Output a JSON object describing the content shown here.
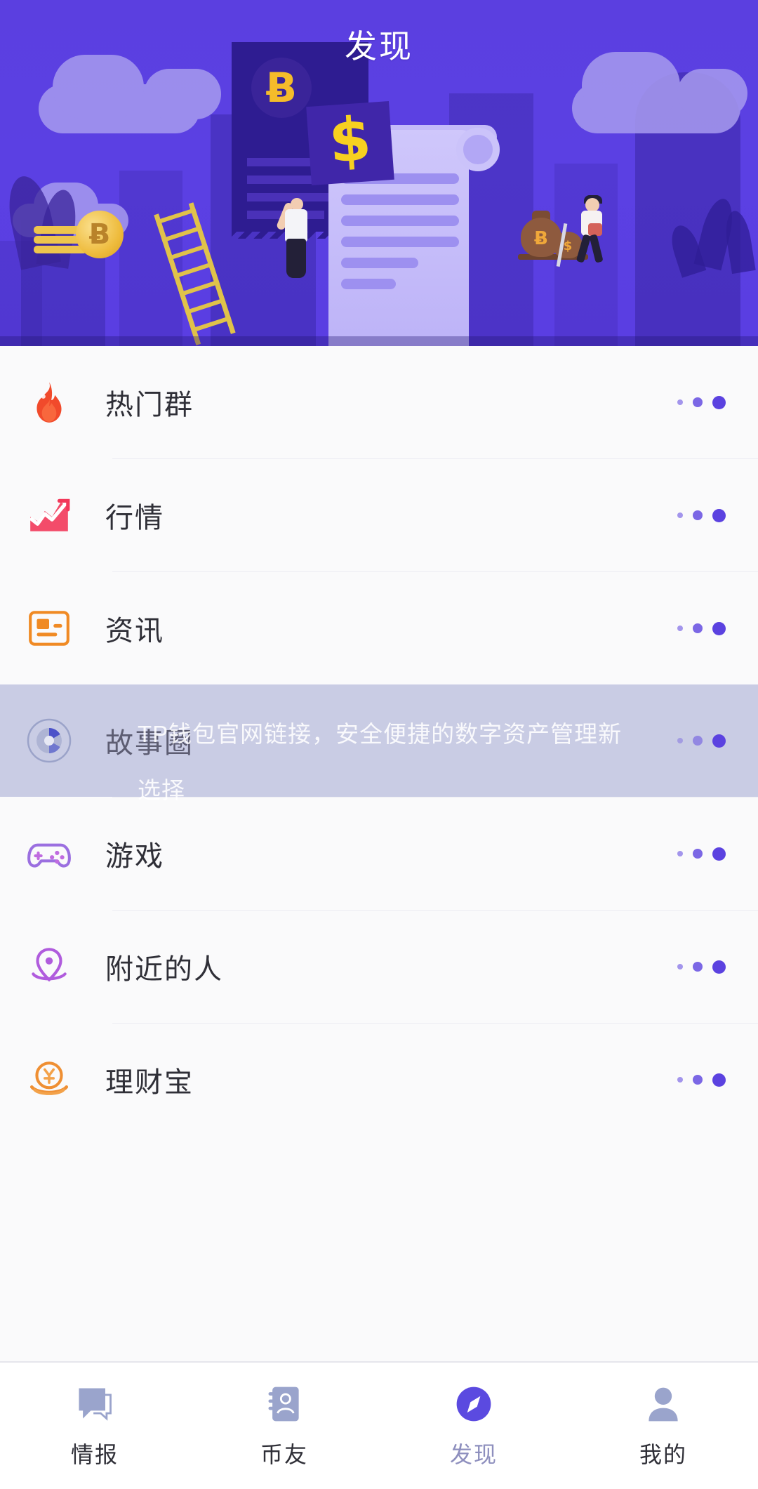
{
  "header": {
    "title": "发现"
  },
  "banner": {
    "alt": "crypto-finance-illustration",
    "btc_symbol": "Ƀ",
    "dollar_symbol": "$",
    "bag_symbol_1": "Ƀ",
    "bag_symbol_2": "$",
    "coin_symbol": "Ƀ"
  },
  "overlay": {
    "watermark": "TP钱包官网链接，安全便捷的数字资产管理新选择"
  },
  "menu": {
    "items": [
      {
        "label": "热门群",
        "icon": "fire-icon",
        "color": "#f14a2b",
        "highlight": false
      },
      {
        "label": "行情",
        "icon": "trend-chart-icon",
        "color": "#f2385a",
        "highlight": false
      },
      {
        "label": "资讯",
        "icon": "news-card-icon",
        "color": "#f08a24",
        "highlight": false
      },
      {
        "label": "故事圈",
        "icon": "aperture-icon",
        "color": "#7b87c4",
        "highlight": true
      },
      {
        "label": "游戏",
        "icon": "gamepad-icon",
        "color": "#9b6fe0",
        "highlight": false
      },
      {
        "label": "附近的人",
        "icon": "location-pin-icon",
        "color": "#b05cdd",
        "highlight": false
      },
      {
        "label": "理财宝",
        "icon": "coin-hand-icon",
        "color": "#ef8f33",
        "highlight": false
      }
    ]
  },
  "tabbar": {
    "items": [
      {
        "label": "情报",
        "icon": "chat-bubble-icon",
        "active": false
      },
      {
        "label": "币友",
        "icon": "contact-book-icon",
        "active": false
      },
      {
        "label": "发现",
        "icon": "compass-icon",
        "active": true
      },
      {
        "label": "我的",
        "icon": "person-icon",
        "active": false
      }
    ]
  },
  "colors": {
    "brand_purple": "#5b40e3",
    "accent_dot": "#5b42e0",
    "highlight_row": "#c9cce4",
    "page_bg": "#fafafb",
    "tab_active_label": "#8e8fbe"
  }
}
